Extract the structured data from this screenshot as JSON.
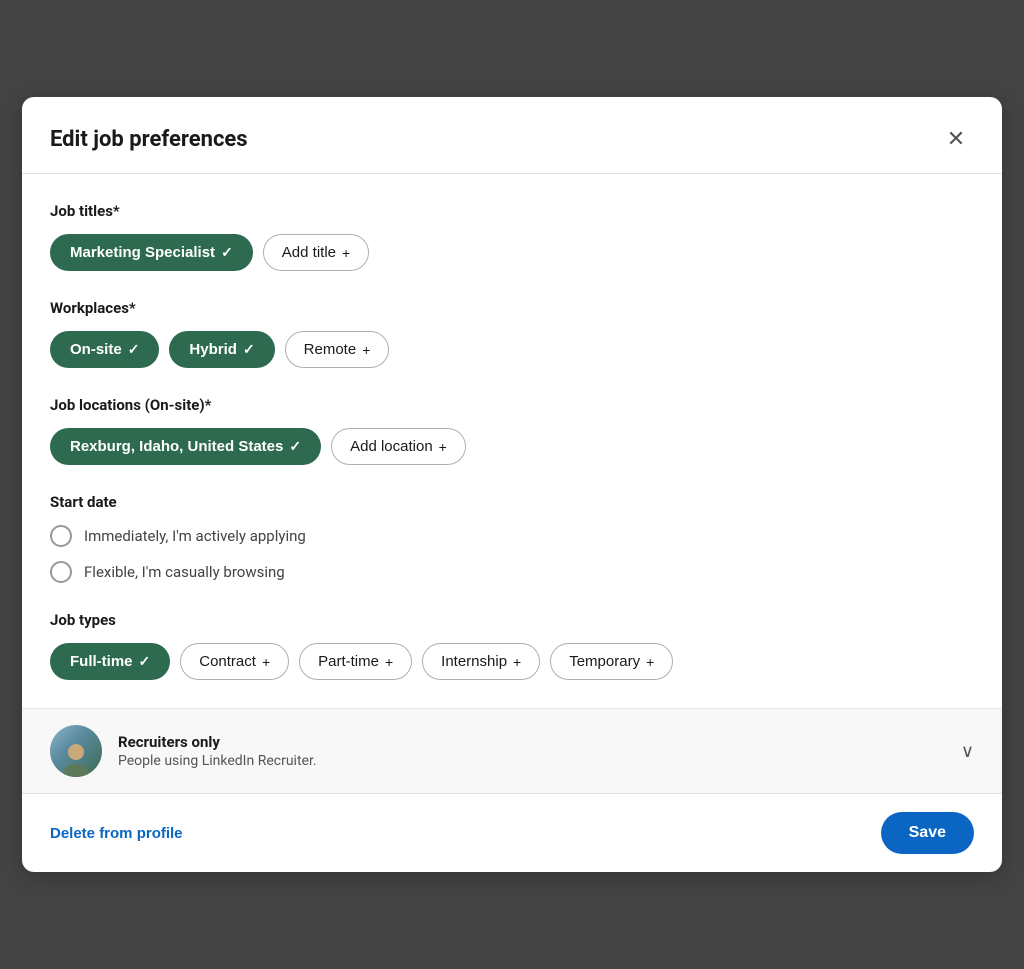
{
  "modal": {
    "title": "Edit job preferences",
    "close_label": "×"
  },
  "sections": {
    "job_titles": {
      "label": "Job titles*",
      "active_chips": [
        {
          "text": "Marketing Specialist",
          "check": "✓"
        }
      ],
      "inactive_chips": [
        {
          "text": "Add title",
          "plus": "+"
        }
      ]
    },
    "workplaces": {
      "label": "Workplaces*",
      "active_chips": [
        {
          "text": "On-site",
          "check": "✓"
        },
        {
          "text": "Hybrid",
          "check": "✓"
        }
      ],
      "inactive_chips": [
        {
          "text": "Remote",
          "plus": "+"
        }
      ]
    },
    "job_locations": {
      "label": "Job locations (On-site)*",
      "active_chips": [
        {
          "text": "Rexburg, Idaho, United States",
          "check": "✓"
        }
      ],
      "inactive_chips": [
        {
          "text": "Add location",
          "plus": "+"
        }
      ]
    },
    "start_date": {
      "label": "Start date",
      "options": [
        {
          "text": "Immediately, I'm actively applying"
        },
        {
          "text": "Flexible, I'm casually browsing"
        }
      ]
    },
    "job_types": {
      "label": "Job types",
      "active_chips": [
        {
          "text": "Full-time",
          "check": "✓"
        }
      ],
      "inactive_chips": [
        {
          "text": "Contract",
          "plus": "+"
        },
        {
          "text": "Part-time",
          "plus": "+"
        },
        {
          "text": "Internship",
          "plus": "+"
        },
        {
          "text": "Temporary",
          "plus": "+"
        }
      ]
    }
  },
  "recruiter_bar": {
    "title": "Recruiters only",
    "subtitle": "People using LinkedIn Recruiter."
  },
  "footer": {
    "delete_label": "Delete from profile",
    "save_label": "Save"
  }
}
